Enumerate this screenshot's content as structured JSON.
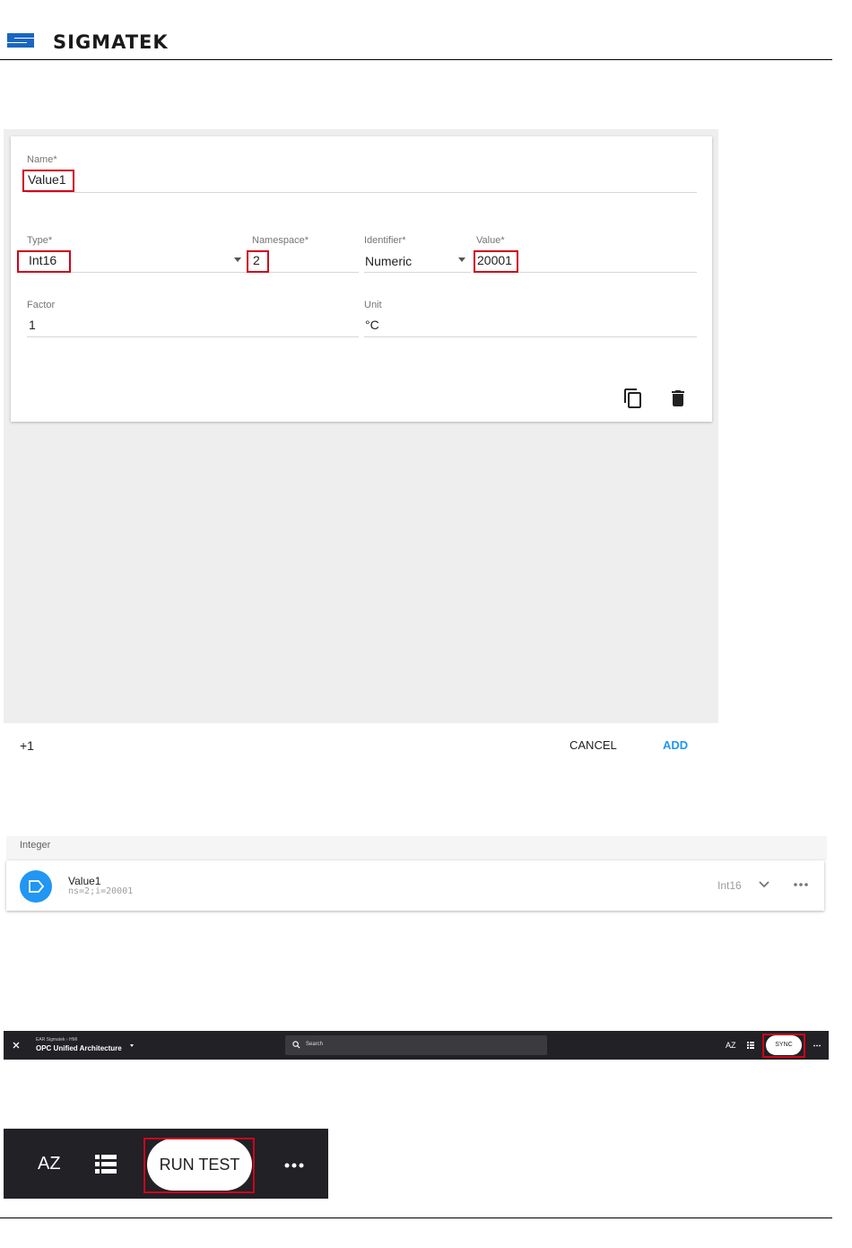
{
  "header": {
    "brand": "SIGMATEK"
  },
  "dialog": {
    "fields": {
      "name": {
        "label": "Name*",
        "value": "Value1"
      },
      "type": {
        "label": "Type*",
        "value": "Int16"
      },
      "namespace": {
        "label": "Namespace*",
        "value": "2"
      },
      "identifier": {
        "label": "Identifier*",
        "value": "Numeric"
      },
      "value": {
        "label": "Value*",
        "value": "20001"
      },
      "factor": {
        "label": "Factor",
        "value": "1"
      },
      "unit": {
        "label": "Unit",
        "value": "°C"
      }
    },
    "actions": {
      "copy_icon": "copy-icon",
      "delete_icon": "trash-icon"
    },
    "footer": {
      "add_count": "+1",
      "cancel": "CANCEL",
      "add": "ADD"
    }
  },
  "list": {
    "group": "Integer",
    "item": {
      "name": "Value1",
      "node_id": "ns=2;i=20001",
      "type": "Int16"
    }
  },
  "toolbar": {
    "breadcrumb": "EAR Sigmatek  ›  HMI",
    "title": "OPC Unified Architecture",
    "search_placeholder": "Search",
    "sort_icon": "AZ",
    "sync": "SYNC"
  },
  "runbar": {
    "sort_icon": "AZ",
    "run": "RUN TEST"
  },
  "colors": {
    "accent": "#2196f3",
    "highlight": "#d0021b",
    "toolbar": "#212126"
  }
}
